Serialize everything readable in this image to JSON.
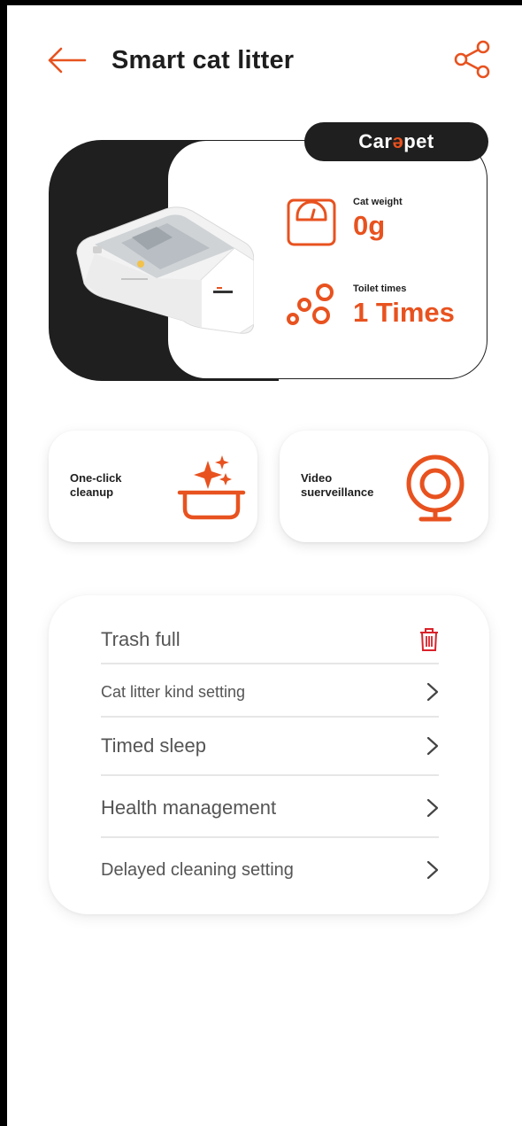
{
  "header": {
    "title": "Smart cat litter",
    "back_icon": "arrow-left-icon",
    "share_icon": "share-icon"
  },
  "device_card": {
    "brand_prefix": "Car",
    "brand_accent": "ə",
    "brand_suffix": "pet",
    "weight_label": "Cat weight",
    "weight_value": "0g",
    "toilet_label": "Toilet times",
    "toilet_value": "1 Times"
  },
  "actions": {
    "cleanup_label": "One-click cleanup",
    "video_label": "Video suerveillance"
  },
  "settings": {
    "trash": "Trash full",
    "litter_kind": "Cat litter kind setting",
    "timed_sleep": "Timed sleep",
    "health": "Health management",
    "delayed_cleaning": "Delayed cleaning setting"
  },
  "colors": {
    "accent": "#e8521f",
    "dark": "#1f1f1f",
    "trash_red": "#d9222a"
  }
}
